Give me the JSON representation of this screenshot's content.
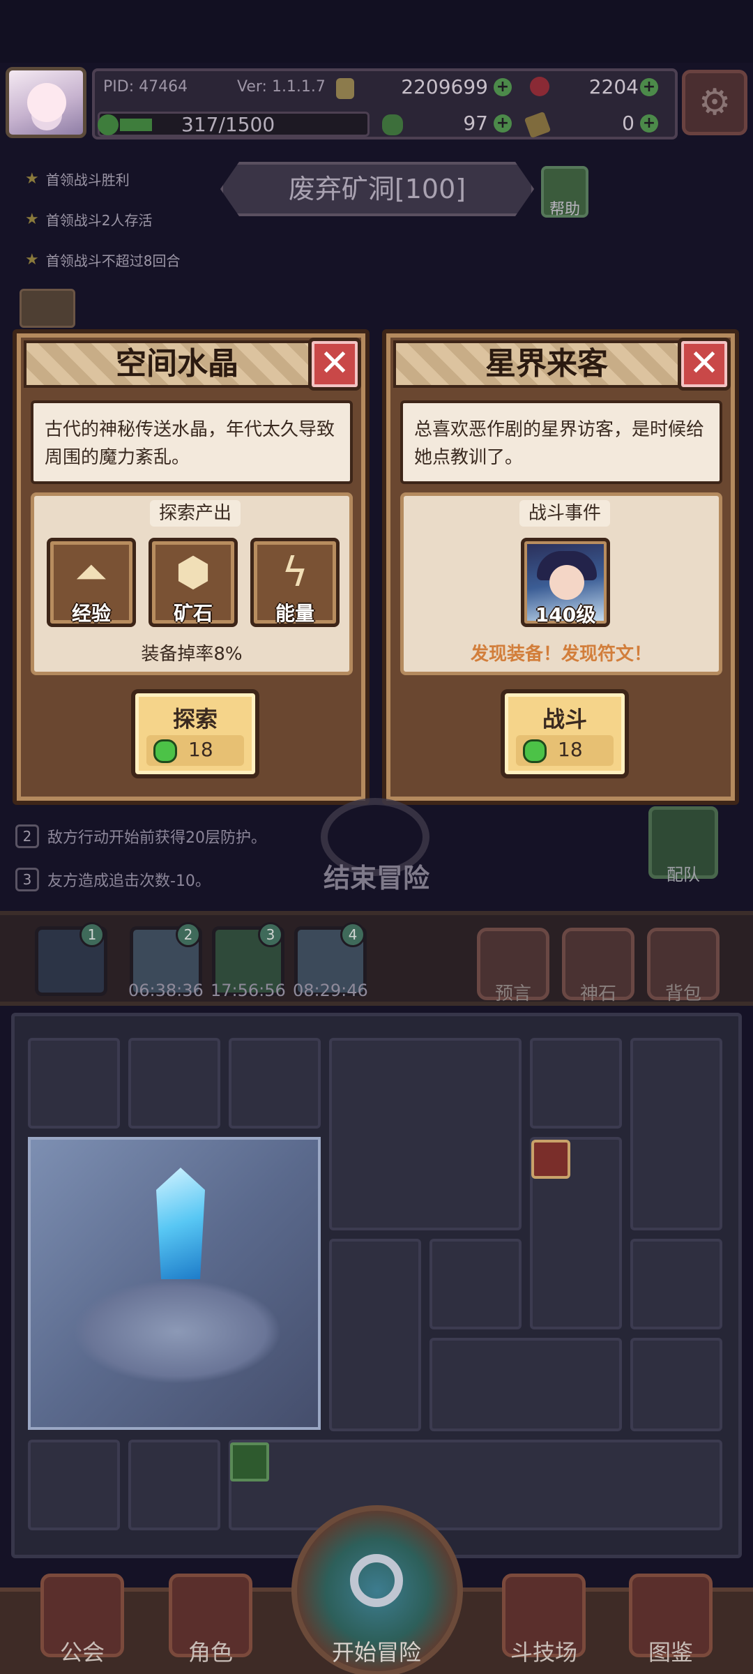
{
  "header": {
    "pid": "PID: 47464",
    "version": "Ver: 1.1.1.7",
    "gold": "2209699",
    "gems": "2204",
    "exp": "317/1500",
    "clover_count": "97",
    "item_count": "0"
  },
  "quests": [
    "首领战斗胜利",
    "首领战斗2人存活",
    "首领战斗不超过8回合"
  ],
  "stage": {
    "name": "废弃矿洞[100]",
    "help_label": "帮助"
  },
  "card_left": {
    "title": "空间水晶",
    "close": "✕",
    "description": "古代的神秘传送水晶，年代太久导致周围的魔力紊乱。",
    "section_title": "探索产出",
    "resources": [
      {
        "label": "经验",
        "icon": "exp-arrow-icon"
      },
      {
        "label": "矿石",
        "icon": "ore-icon"
      },
      {
        "label": "能量",
        "icon": "lightning-icon"
      }
    ],
    "drop_rate": "装备掉率8%",
    "action_label": "探索",
    "cost": "18"
  },
  "card_right": {
    "title": "星界来客",
    "close": "✕",
    "description": "总喜欢恶作剧的星界访客，是时候给她点教训了。",
    "section_title": "战斗事件",
    "enemy_level": "140级",
    "event_note": "发现装备！发现符文！",
    "action_label": "战斗",
    "cost": "18"
  },
  "rules": [
    {
      "num": "2",
      "text": "敌方行动开始前获得20层防护。"
    },
    {
      "num": "3",
      "text": "友方造成追击次数-10。"
    }
  ],
  "end_adventure": "结束冒险",
  "team_label": "配队",
  "slots": [
    {
      "num": "1",
      "timer": ""
    },
    {
      "num": "2",
      "timer": "06:38:36"
    },
    {
      "num": "3",
      "timer": "17:56:56"
    },
    {
      "num": "4",
      "timer": "08:29:46"
    }
  ],
  "side_buttons": [
    "预言",
    "神石",
    "背包"
  ],
  "nav": {
    "guild": "公会",
    "character": "角色",
    "start": "开始冒险",
    "arena": "斗技场",
    "codex": "图鉴"
  },
  "colors": {
    "background": "#151226",
    "card_border": "#3d2518",
    "card_parchment": "#f3e9dc",
    "close_red": "#c94848",
    "gem_green": "#4cc247",
    "event_orange": "#d27e3b"
  }
}
